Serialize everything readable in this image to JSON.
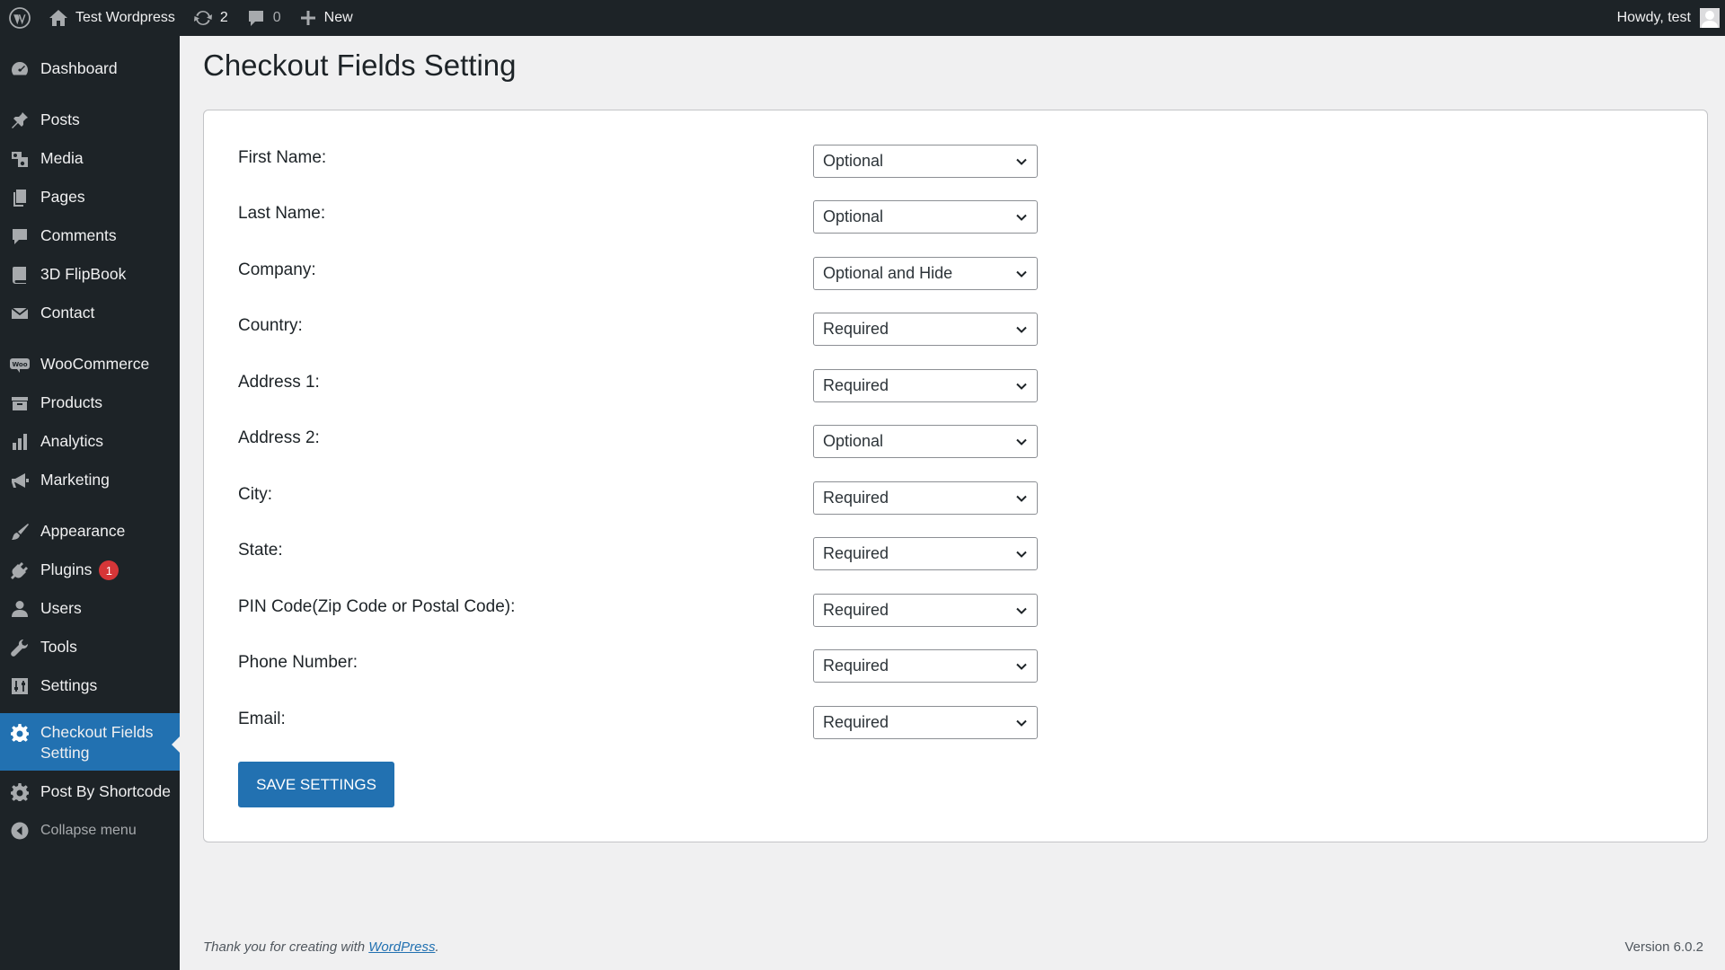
{
  "adminbar": {
    "wp_logo_icon": "wordpress-logo-icon",
    "site_name": "Test Wordpress",
    "updates_count": "2",
    "comments_count": "0",
    "new_label": "New",
    "howdy": "Howdy, test"
  },
  "sidebar": {
    "items": [
      {
        "label": "Dashboard",
        "icon": "dashboard-icon"
      },
      {
        "label": "Posts",
        "icon": "pin-icon"
      },
      {
        "label": "Media",
        "icon": "media-icon"
      },
      {
        "label": "Pages",
        "icon": "pages-icon"
      },
      {
        "label": "Comments",
        "icon": "comment-icon"
      },
      {
        "label": "3D FlipBook",
        "icon": "book-icon"
      },
      {
        "label": "Contact",
        "icon": "mail-icon"
      },
      {
        "label": "WooCommerce",
        "icon": "woo-icon"
      },
      {
        "label": "Products",
        "icon": "archive-icon"
      },
      {
        "label": "Analytics",
        "icon": "bar-chart-icon"
      },
      {
        "label": "Marketing",
        "icon": "megaphone-icon"
      },
      {
        "label": "Appearance",
        "icon": "brush-icon"
      },
      {
        "label": "Plugins",
        "icon": "plugin-icon",
        "badge": "1"
      },
      {
        "label": "Users",
        "icon": "user-icon"
      },
      {
        "label": "Tools",
        "icon": "wrench-icon"
      },
      {
        "label": "Settings",
        "icon": "settings-sliders-icon"
      },
      {
        "label": "Checkout Fields Setting",
        "icon": "gear-icon",
        "current": true
      },
      {
        "label": "Post By Shortcode",
        "icon": "gear-icon"
      },
      {
        "label": "Collapse menu",
        "icon": "collapse-icon"
      }
    ]
  },
  "page": {
    "title": "Checkout Fields Setting"
  },
  "form": {
    "fields": [
      {
        "label": "First Name:",
        "value": "Optional"
      },
      {
        "label": "Last Name:",
        "value": "Optional"
      },
      {
        "label": "Company:",
        "value": "Optional and Hide"
      },
      {
        "label": "Country:",
        "value": "Required"
      },
      {
        "label": "Address 1:",
        "value": "Required"
      },
      {
        "label": "Address 2:",
        "value": "Optional"
      },
      {
        "label": "City:",
        "value": "Required"
      },
      {
        "label": "State:",
        "value": "Required"
      },
      {
        "label": "PIN Code(Zip Code or Postal Code):",
        "value": "Required"
      },
      {
        "label": "Phone Number:",
        "value": "Required"
      },
      {
        "label": "Email:",
        "value": "Required"
      }
    ],
    "save_label": "SAVE SETTINGS"
  },
  "footer": {
    "thanks_prefix": "Thank you for creating with ",
    "thanks_link": "WordPress",
    "thanks_suffix": ".",
    "version": "Version 6.0.2"
  },
  "colors": {
    "adminbar_bg": "#1d2327",
    "accent": "#2271b1",
    "badge": "#d63638",
    "page_bg": "#f0f0f1"
  }
}
